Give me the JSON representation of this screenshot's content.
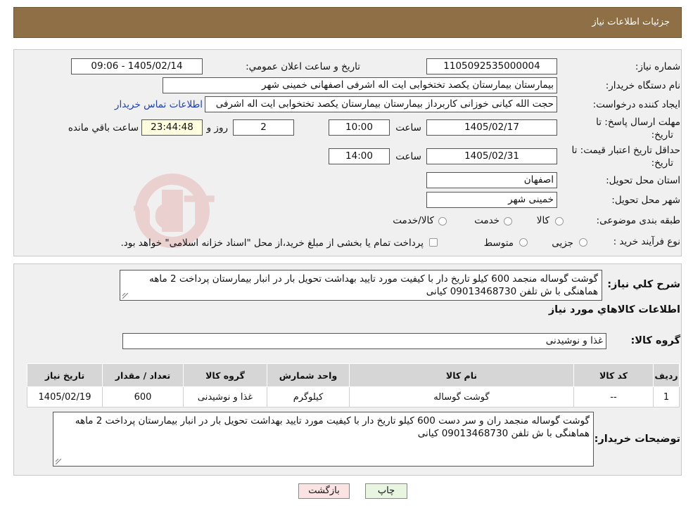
{
  "header": {
    "title": "جزئیات اطلاعات نیاز"
  },
  "form": {
    "need_number_label": "شماره نیاز:",
    "need_number": "1105092535000004",
    "announce_label": "تاریخ و ساعت اعلان عمومي:",
    "announce_value": "1405/02/14 - 09:06",
    "buyer_org_label": "نام دستگاه خریدار:",
    "buyer_org": "بیمارستان بیمارستان یکصد تختخوابی ایت اله اشرفی اصفهانی خمینی شهر",
    "creator_label": "ایجاد کننده درخواست:",
    "creator": "حجت الله کیانی خوزانی کاربرداز بیمارستان بیمارستان یکصد تختخوابی ایت اله اشرفی",
    "contact_link": "اطلاعات تماس خریدار",
    "deadline_label_1": "مهلت ارسال پاسخ: تا",
    "deadline_label_2": "تاریخ:",
    "deadline_date": "1405/02/17",
    "time_label": "ساعت",
    "deadline_time": "10:00",
    "days_value": "2",
    "days_label": "روز و",
    "remaining_time": "23:44:48",
    "remaining_label": "ساعت باقي مانده",
    "validity_label_1": "حداقل تاریخ اعتبار قیمت: تا",
    "validity_label_2": "تاریخ:",
    "validity_date": "1405/02/31",
    "validity_time_label": "ساعت",
    "validity_time": "14:00",
    "province_label": "استان محل تحویل:",
    "province": "اصفهان",
    "city_label": "شهر محل تحویل:",
    "city": "خمینی شهر",
    "category_label": "طبقه بندی موضوعی:",
    "category_options": [
      "کالا",
      "خدمت",
      "کالا/خدمت"
    ],
    "process_label": "نوع فرآیند خرید :",
    "process_options": [
      "جزیی",
      "متوسط"
    ],
    "process_note": "پرداخت تمام یا بخشی از مبلغ خرید،از محل \"اسناد خزانه اسلامی\" خواهد بود."
  },
  "summary": {
    "label": "شرح کلي نیاز:",
    "text": "گوشت گوساله منجمد 600 کیلو تاریخ دار  با کیفیت مورد تایید بهداشت  تحویل بار در انبار بیمارستان پرداخت 2 ماهه هماهنگی با ش تلفن 09013468730 کیانی",
    "goods_info_title": "اطلاعات کالاهاي مورد نیاز",
    "goods_group_label": "گروه کالا:",
    "goods_group": "غذا و نوشیدنی",
    "table_headers": [
      "ردیف",
      "کد کالا",
      "نام کالا",
      "واحد شمارش",
      "گروه کالا",
      "تعداد / مقدار",
      "تاریخ نیاز"
    ],
    "rows": [
      {
        "index": "1",
        "code": "--",
        "name": "گوشت گوساله",
        "unit": "کیلوگرم",
        "group": "غذا و نوشیدنی",
        "qty": "600",
        "date": "1405/02/19"
      }
    ],
    "buyer_notes_label": "توضیحات خریدار:",
    "buyer_notes": "گوشت گوساله منجمد ران و سر دست  600 کیلو تاریخ دار  با کیفیت مورد تایید بهداشت  تحویل بار در انبار بیمارستان پرداخت 2 ماهه هماهنگی با ش تلفن 09013468730 کیانی"
  },
  "buttons": {
    "print": "چاپ",
    "back": "بازگشت"
  },
  "watermark": {
    "text": "AriaTender.neT"
  },
  "colors": {
    "header_bg": "#8f6f45",
    "panel_bg": "#f0f0f0",
    "link": "#1a3fb8",
    "print_btn": "#e8f5e0",
    "back_btn": "#fbe3e3"
  }
}
